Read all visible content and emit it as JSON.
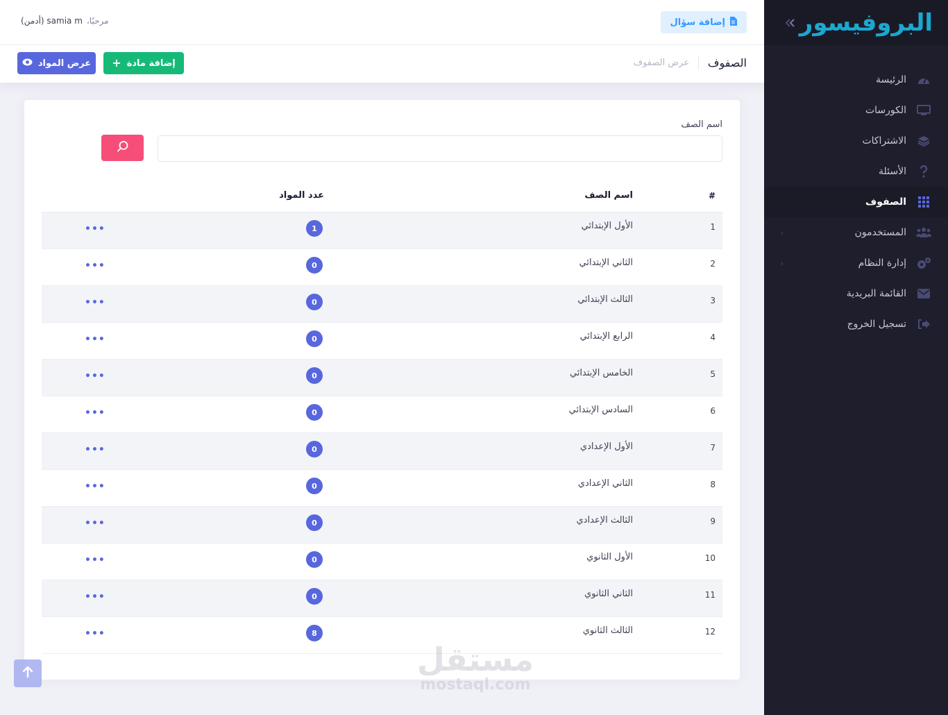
{
  "sidebar": {
    "brand": "البروفيسور",
    "items": [
      {
        "label": "الرئيسة",
        "icon": "gauge-icon",
        "active": false,
        "has_arrow": false
      },
      {
        "label": "الكورسات",
        "icon": "monitor-icon",
        "active": false,
        "has_arrow": false
      },
      {
        "label": "الاشتراكات",
        "icon": "layers-icon",
        "active": false,
        "has_arrow": false
      },
      {
        "label": "الأسئلة",
        "icon": "question-icon",
        "active": false,
        "has_arrow": false
      },
      {
        "label": "الصفوف",
        "icon": "grid-icon",
        "active": true,
        "has_arrow": false
      },
      {
        "label": "المستخدمون",
        "icon": "users-icon",
        "active": false,
        "has_arrow": true
      },
      {
        "label": "إدارة النظام",
        "icon": "cogs-icon",
        "active": false,
        "has_arrow": true
      },
      {
        "label": "القائمة البريدية",
        "icon": "envelope-icon",
        "active": false,
        "has_arrow": false
      },
      {
        "label": "تسجيل الخروج",
        "icon": "sign-out-icon",
        "active": false,
        "has_arrow": false
      }
    ]
  },
  "header": {
    "add_question_label": "إضافة سؤال",
    "greeting_prefix": "مرحبًا،",
    "user_name": "samia m (أدمن)"
  },
  "subheader": {
    "title": "الصفوف",
    "subtitle": "عرض الصفوف",
    "add_subject_label": "إضافة مادة",
    "view_subjects_label": "عرض المواد"
  },
  "search": {
    "label": "اسم الصف",
    "value": "",
    "placeholder": ""
  },
  "table": {
    "columns": {
      "num": "#",
      "name": "اسم الصف",
      "count": "عدد المواد"
    },
    "rows": [
      {
        "num": "1",
        "name": "الأول الإبتدائي",
        "count": "1"
      },
      {
        "num": "2",
        "name": "الثاني الإبتدائي",
        "count": "0"
      },
      {
        "num": "3",
        "name": "الثالث الإبتدائي",
        "count": "0"
      },
      {
        "num": "4",
        "name": "الرابع الإبتدائي",
        "count": "0"
      },
      {
        "num": "5",
        "name": "الخامس الإبتدائي",
        "count": "0"
      },
      {
        "num": "6",
        "name": "السادس الإبتدائي",
        "count": "0"
      },
      {
        "num": "7",
        "name": "الأول الإعدادي",
        "count": "0"
      },
      {
        "num": "8",
        "name": "الثاني الإعدادي",
        "count": "0"
      },
      {
        "num": "9",
        "name": "الثالث الإعدادي",
        "count": "0"
      },
      {
        "num": "10",
        "name": "الأول الثانوي",
        "count": "0"
      },
      {
        "num": "11",
        "name": "الثاني الثانوي",
        "count": "0"
      },
      {
        "num": "12",
        "name": "الثالث الثانوي",
        "count": "8"
      }
    ],
    "row_action": "•••"
  },
  "watermark": {
    "arabic": "مستقل",
    "latin": "mostaql.com"
  },
  "colors": {
    "accent": "#5867dd",
    "brand": "#1ba8d0",
    "search_button": "#f64e79",
    "add_button": "#17b978",
    "sidebar_bg": "#1e1e2d"
  }
}
